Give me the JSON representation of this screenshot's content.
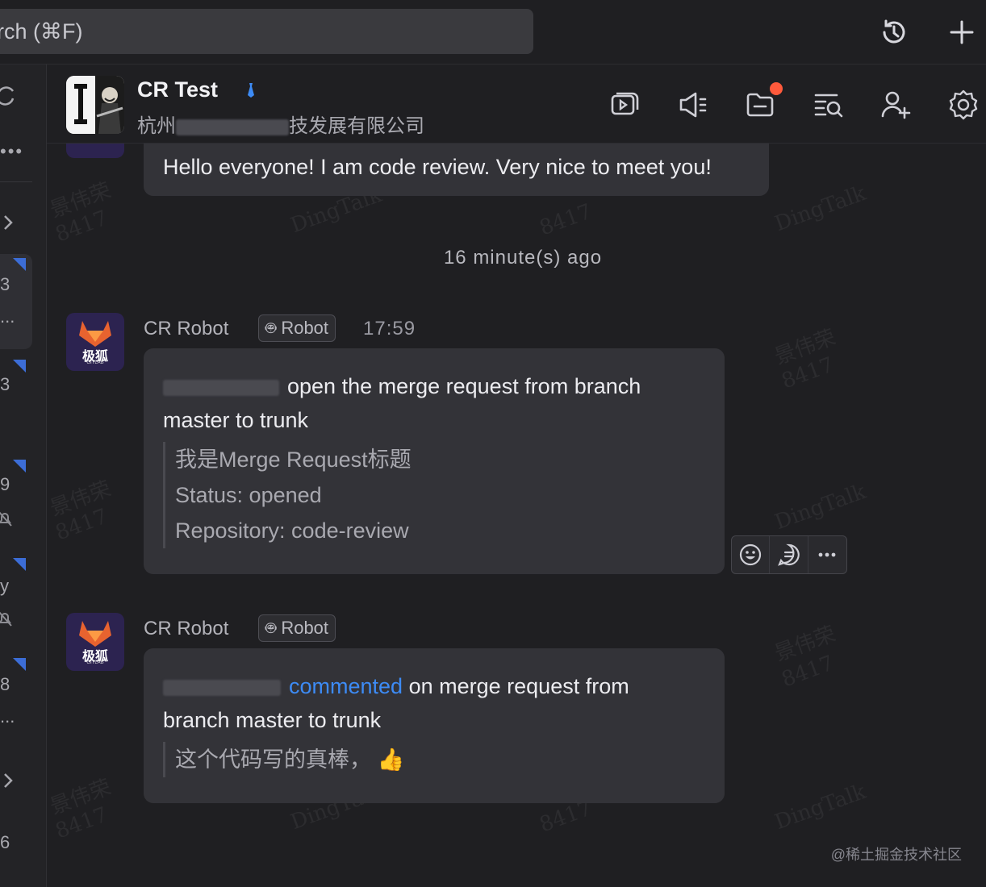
{
  "topbar": {
    "search_text": "rch (⌘F)",
    "icons": [
      "history-icon",
      "plus-icon"
    ]
  },
  "sidebar": {
    "items": [
      {
        "text": "3"
      },
      {
        "text": "..."
      },
      {
        "text": "3"
      },
      {
        "text": "9"
      },
      {
        "text": "y"
      },
      {
        "text": "8"
      },
      {
        "text": "..."
      },
      {
        "text": "6"
      }
    ]
  },
  "header": {
    "title": "CR Test",
    "subtitle_prefix": "杭州",
    "subtitle_suffix": "技发展有限公司",
    "icons": [
      "screen-share-icon",
      "announcement-icon",
      "files-icon",
      "search-history-icon",
      "add-member-icon",
      "settings-icon"
    ],
    "badge_color": "#ff5a3c"
  },
  "messages": {
    "first_bubble": "Hello everyone! I am code review. Very nice to meet you!",
    "divider_time": "16 minute(s) ago",
    "msg1": {
      "avatar_text": "极狐",
      "avatar_sub": "GITLAB",
      "sender": "CR Robot",
      "tag": "Robot",
      "time": "17:59",
      "line1": "open the merge request from branch",
      "line2": "master to trunk",
      "link": "我是Merge Request标题",
      "status": "Status: opened",
      "repo": "Repository: code-review"
    },
    "msg2": {
      "avatar_text": "极狐",
      "avatar_sub": "GITLAB",
      "sender": "CR Robot",
      "tag": "Robot",
      "link": "commented",
      "line1_rest": "on merge request from",
      "line2": "branch master to trunk",
      "quote": "这个代码写的真棒，",
      "emoji": "👍"
    },
    "action_icons": [
      "emoji-icon",
      "reply-icon",
      "more-icon"
    ]
  },
  "watermarks": [
    "景伟荣",
    "8417",
    "DingTalk"
  ],
  "credit": "@稀土掘金技术社区",
  "colors": {
    "accent": "#3d8bf5",
    "gitlab_orange": "#e8632f",
    "bubble": "#333338"
  }
}
